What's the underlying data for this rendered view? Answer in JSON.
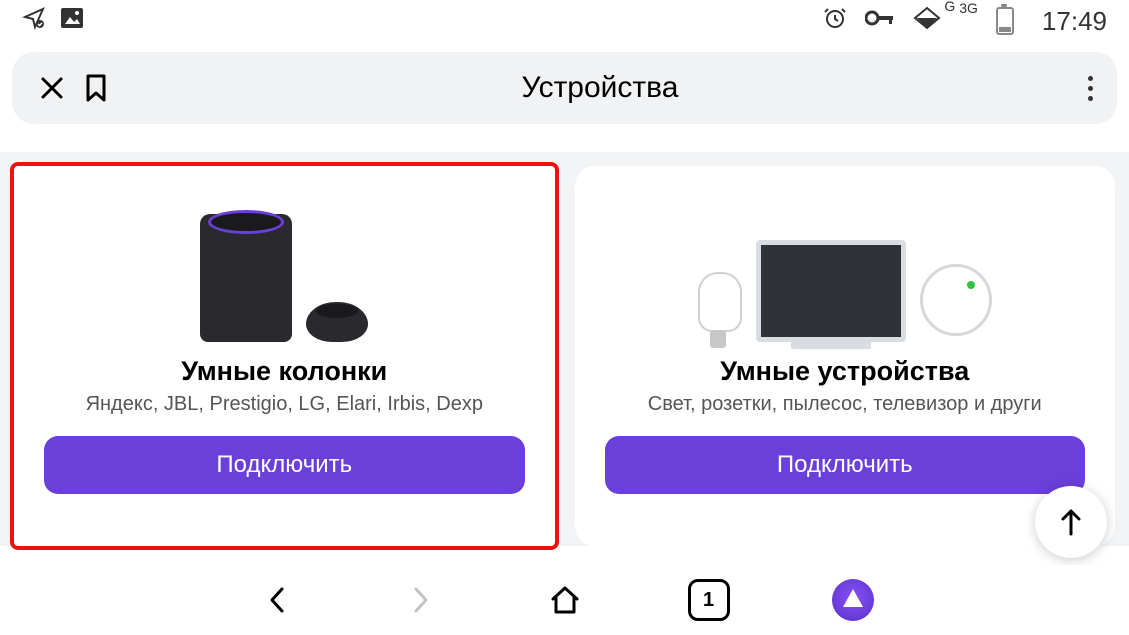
{
  "status": {
    "time": "17:49",
    "net_g": "G",
    "net_3g": "3G"
  },
  "browser_bar": {
    "title": "Устройства"
  },
  "cards": {
    "speakers": {
      "title": "Умные колонки",
      "subtitle": "Яндекс, JBL, Prestigio, LG, Elari, Irbis, Dexp",
      "button": "Подключить"
    },
    "devices": {
      "title": "Умные устройства",
      "subtitle": "Свет, розетки, пылесос, телевизор и други",
      "button": "Подключить"
    }
  },
  "bottom_nav": {
    "tabs_count": "1"
  }
}
